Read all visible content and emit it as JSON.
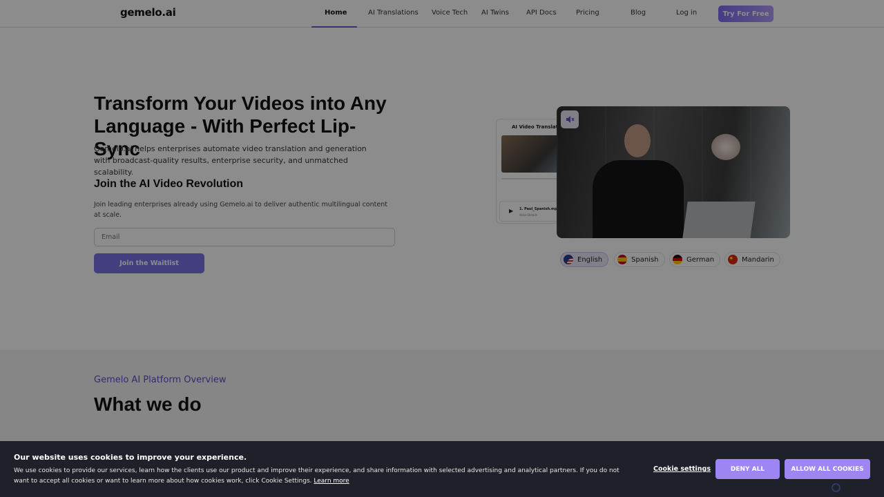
{
  "nav": {
    "logo": "gemelo.ai",
    "items": [
      {
        "label": "Home"
      },
      {
        "label": "AI Translations"
      },
      {
        "label": "Voice Tech"
      },
      {
        "label": "AI Twins"
      },
      {
        "label": "API Docs"
      },
      {
        "label": "Pricing"
      },
      {
        "label": "Blog"
      },
      {
        "label": "Log in"
      }
    ],
    "cta": "Try For Free"
  },
  "hero": {
    "title": "Transform Your Videos into Any Language - With Perfect Lip-Sync",
    "subtitle": "Gemelo.ai helps enterprises automate video translation and generation with broadcast-quality results, enterprise security, and unmatched scalability.",
    "join_title": "Join the AI Video Revolution",
    "join_subtitle": "Join leading enterprises already using Gemelo.ai to deliver authentic multilingual content at scale.",
    "email_placeholder": "Email",
    "waitlist_button": "Join the Waitlist"
  },
  "preview": {
    "card_title": "AI Video Translation",
    "file_name": "1. Paul_Spanish.mp4",
    "file_sub": "Voice Details"
  },
  "languages": [
    {
      "label": "English"
    },
    {
      "label": "Spanish"
    },
    {
      "label": "German"
    },
    {
      "label": "Mandarin"
    }
  ],
  "section2": {
    "kicker": "Gemelo AI Platform Overview",
    "title": "What we do"
  },
  "cookie": {
    "title": "Our website uses cookies to improve your experience.",
    "text": "We use cookies to provide our services, learn how the clients use our product and improve their experience, and share information with selected advertising and analytical partners. If you do not want to accept all cookies or want to learn more about how cookies work, click Cookie Settings.",
    "learn_more": "Learn more",
    "settings": "Cookie settings",
    "deny": "DENY ALL",
    "allow": "ALLOW ALL COOKIES"
  },
  "colors": {
    "accent": "#7a72e6",
    "cookie_button": "#9d86f3",
    "cookie_bg": "#1e2129"
  }
}
